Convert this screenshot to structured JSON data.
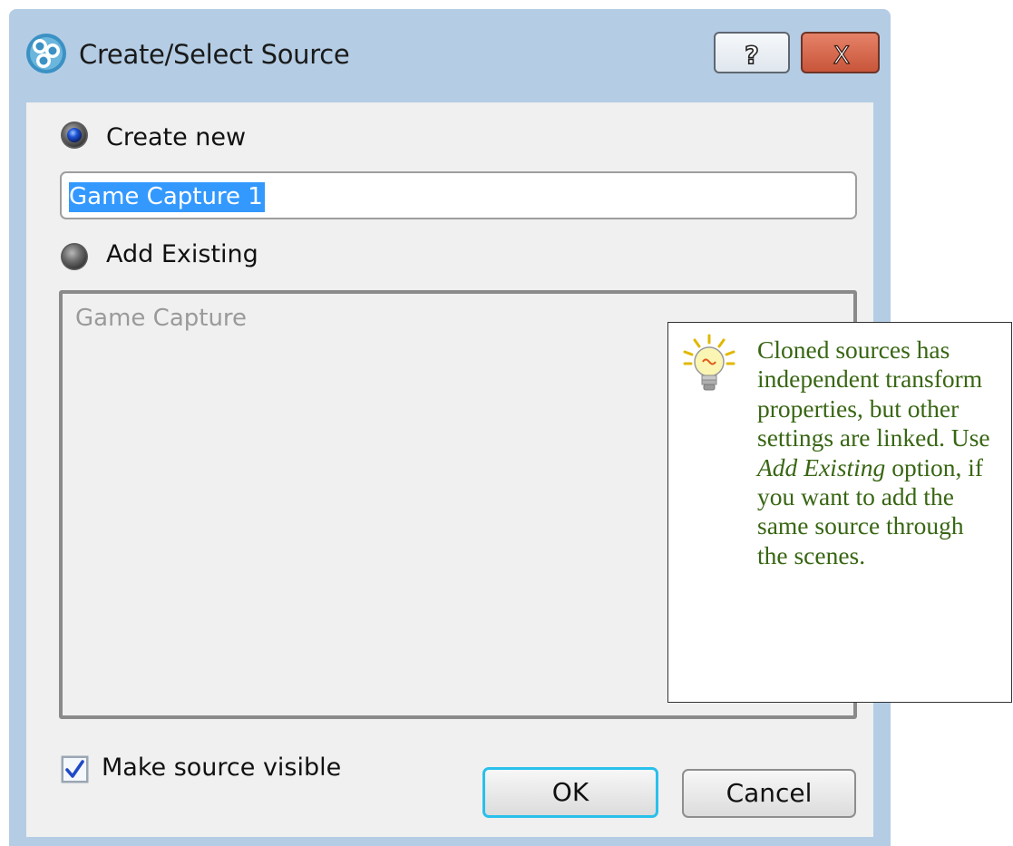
{
  "window": {
    "title": "Create/Select Source",
    "help_glyph": "?",
    "close_glyph": "X"
  },
  "options": {
    "create_new_label": "Create new",
    "create_new_selected": true,
    "add_existing_label": "Add Existing",
    "add_existing_selected": false
  },
  "name_input": {
    "value": "Game Capture 1"
  },
  "existing_list": {
    "items": [
      "Game Capture"
    ]
  },
  "visible_checkbox": {
    "label": "Make source visible",
    "checked": true
  },
  "buttons": {
    "ok_label": "OK",
    "cancel_label": "Cancel"
  },
  "tooltip": {
    "text_1": "Cloned sources has independent transform properties, but other settings are linked. Use ",
    "emphasis": "Add Existing",
    "text_2": " option, if you want to add the same source through the scenes."
  },
  "icons": {
    "app": "obs-logo-icon",
    "help": "question-mark-icon",
    "close": "close-icon",
    "tip": "lightbulb-icon",
    "check": "checkmark-icon"
  },
  "colors": {
    "frame": "#b4cde5",
    "close_button": "#c8553a",
    "selection": "#3399ff",
    "ok_focus_border": "#29c0ec",
    "tooltip_text": "#386613"
  }
}
